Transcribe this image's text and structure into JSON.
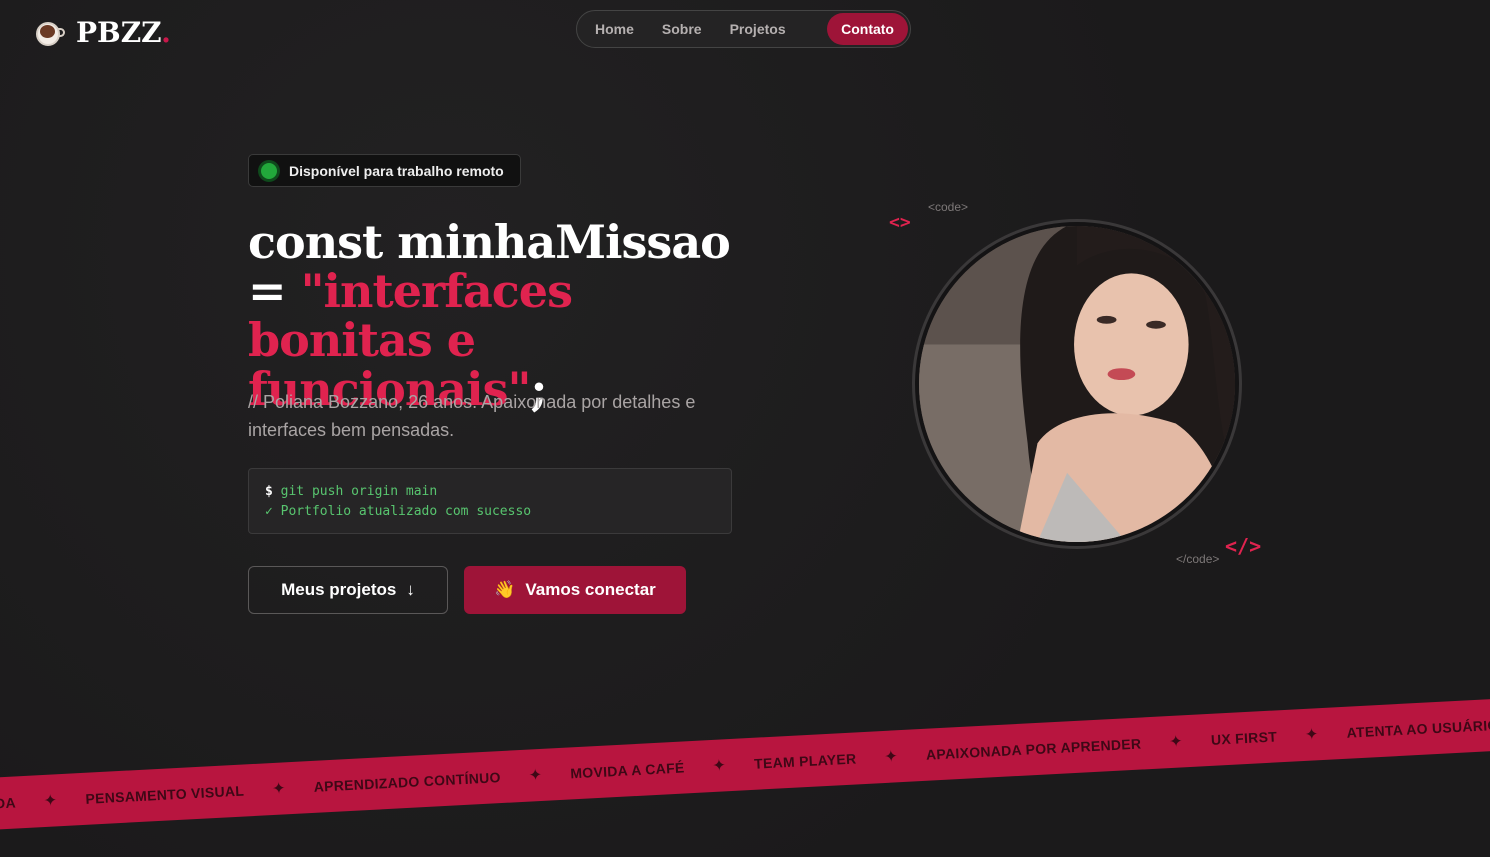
{
  "header": {
    "logo_text": "PBZZ",
    "logo_dot": ".",
    "nav": [
      {
        "label": "Home"
      },
      {
        "label": "Sobre"
      },
      {
        "label": "Projetos"
      },
      {
        "label": "Contato",
        "active": true
      }
    ]
  },
  "hero": {
    "badge": "Disponível para trabalho remoto",
    "headline_part1": "const minhaMissao",
    "headline_part2": "= ",
    "headline_accent": "\"interfaces bonitas e funcionais\"",
    "headline_end": ";",
    "subtitle": "// Poliana Bozzano, 26 anos. Apaixonada por detalhes e interfaces bem pensadas.",
    "terminal": {
      "prompt": "$",
      "command": "git push origin main",
      "output": "✓ Portfolio atualizado com sucesso"
    },
    "btn_projects": "Meus projetos",
    "btn_projects_icon": "↓",
    "btn_connect": "Vamos conectar",
    "btn_connect_icon": "👋"
  },
  "photo": {
    "open_tag": "<code>",
    "close_tag": "</code>",
    "bracket_open": "<>",
    "bracket_close": "</>"
  },
  "band": {
    "items": [
      "DA",
      "PENSAMENTO VISUAL",
      "APRENDIZADO CONTÍNUO",
      "MOVIDA A CAFÉ",
      "TEAM PLAYER",
      "APAIXONADA POR APRENDER",
      "UX FIRST",
      "ATENTA AO USUÁRIO"
    ],
    "separator": "✦"
  },
  "colors": {
    "accent": "#e0234f",
    "accent_dark": "#9e1438",
    "band": "#b8153f",
    "status_green": "#22a83b"
  }
}
